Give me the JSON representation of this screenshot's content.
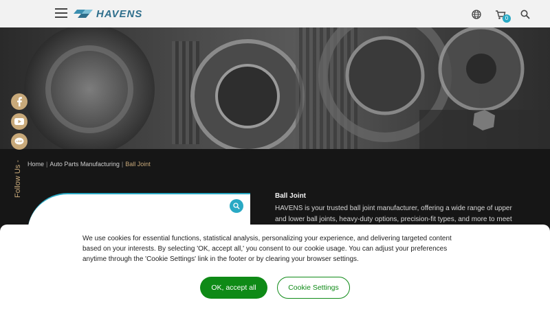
{
  "header": {
    "logo_text": "HAVENS",
    "cart_count": "0",
    "icons": [
      "menu-icon",
      "globe-icon",
      "cart-icon",
      "search-icon"
    ]
  },
  "social": {
    "follow_label": "Follow Us -",
    "items": [
      "facebook-icon",
      "youtube-icon",
      "line-icon"
    ]
  },
  "breadcrumb": {
    "home": "Home",
    "category": "Auto Parts Manufacturing",
    "current": "Ball Joint",
    "separator": "|"
  },
  "product": {
    "title": "Ball Joint",
    "description": "HAVENS is your trusted ball joint manufacturer, offering a wide range of upper and lower ball joints, heavy-duty options, precision-fit types, and more to meet diverse"
  },
  "cookie": {
    "message": "We use cookies for essential functions, statistical analysis, personalizing your experience, and delivering targeted content based on your interests. By selecting 'OK, accept all,' you consent to our cookie usage. You can adjust your preferences anytime through the 'Cookie Settings' link in the footer or by clearing your browser settings.",
    "accept_label": "OK, accept all",
    "settings_label": "Cookie Settings"
  },
  "colors": {
    "accent": "#29a9c4",
    "gold": "#c8a97a",
    "green": "#0e8a16",
    "brand_blue": "#2f6f8c"
  }
}
